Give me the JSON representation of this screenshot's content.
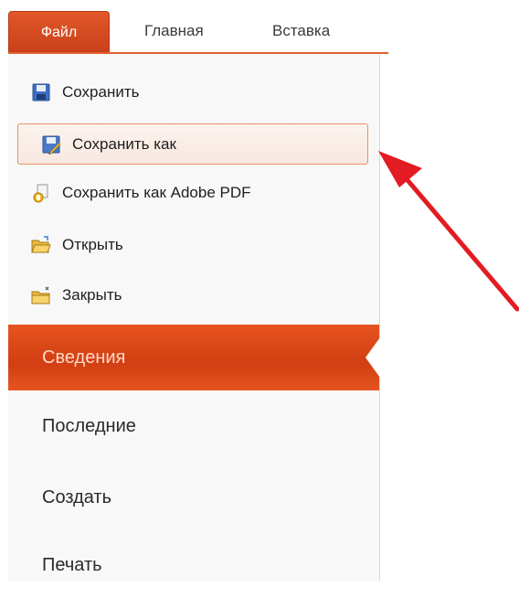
{
  "ribbon": {
    "tabs": [
      {
        "label": "Файл"
      },
      {
        "label": "Главная"
      },
      {
        "label": "Вставка"
      }
    ]
  },
  "file_menu": {
    "commands": [
      {
        "label": "Сохранить",
        "icon": "save-icon"
      },
      {
        "label": "Сохранить как",
        "icon": "save-as-icon",
        "highlighted": true
      },
      {
        "label": "Сохранить как Adobe PDF",
        "icon": "pdf-icon"
      },
      {
        "label": "Открыть",
        "icon": "open-folder-icon"
      },
      {
        "label": "Закрыть",
        "icon": "close-folder-icon"
      }
    ],
    "sections": [
      {
        "label": "Сведения",
        "selected": true
      },
      {
        "label": "Последние"
      },
      {
        "label": "Создать"
      },
      {
        "label": "Печать"
      }
    ]
  },
  "colors": {
    "accent": "#d9481a",
    "highlight_border": "#e5926a",
    "annotation_arrow": "#e31b23"
  }
}
